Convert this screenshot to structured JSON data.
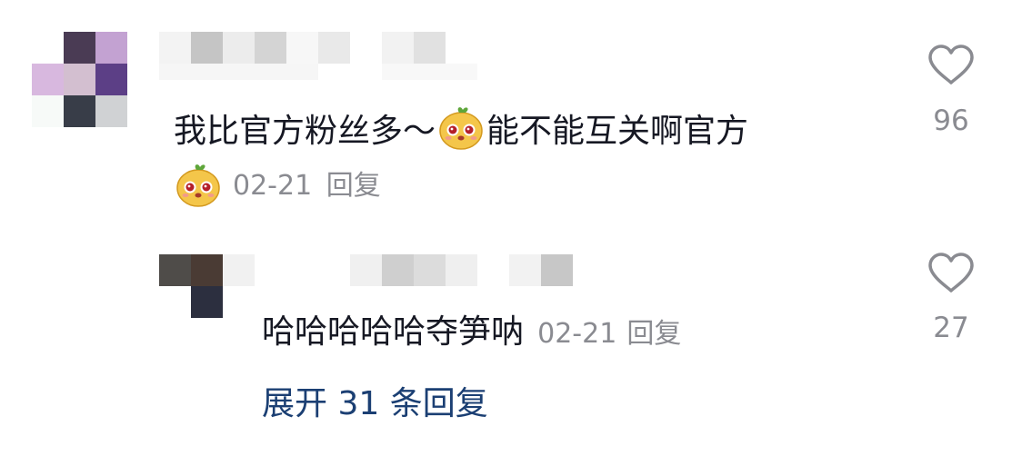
{
  "comment": {
    "text_before": "我比官方粉丝多～",
    "emoji_name": "yellow-cartoon-face-emoji",
    "text_after": "能不能互关啊官方",
    "date": "02-21",
    "reply_label": "回复",
    "like_count": "96"
  },
  "reply": {
    "text": "哈哈哈哈哈夺笋呐",
    "date": "02-21",
    "reply_label": "回复",
    "like_count": "27"
  },
  "expand": {
    "label": "展开 31 条回复"
  },
  "colors": {
    "text": "#161823",
    "meta": "#8a8b91",
    "expand_link": "#1b3f73",
    "heart_outline": "#8a8b91"
  },
  "icons": [
    "heart-outline-icon",
    "yellow-cartoon-face-emoji"
  ]
}
